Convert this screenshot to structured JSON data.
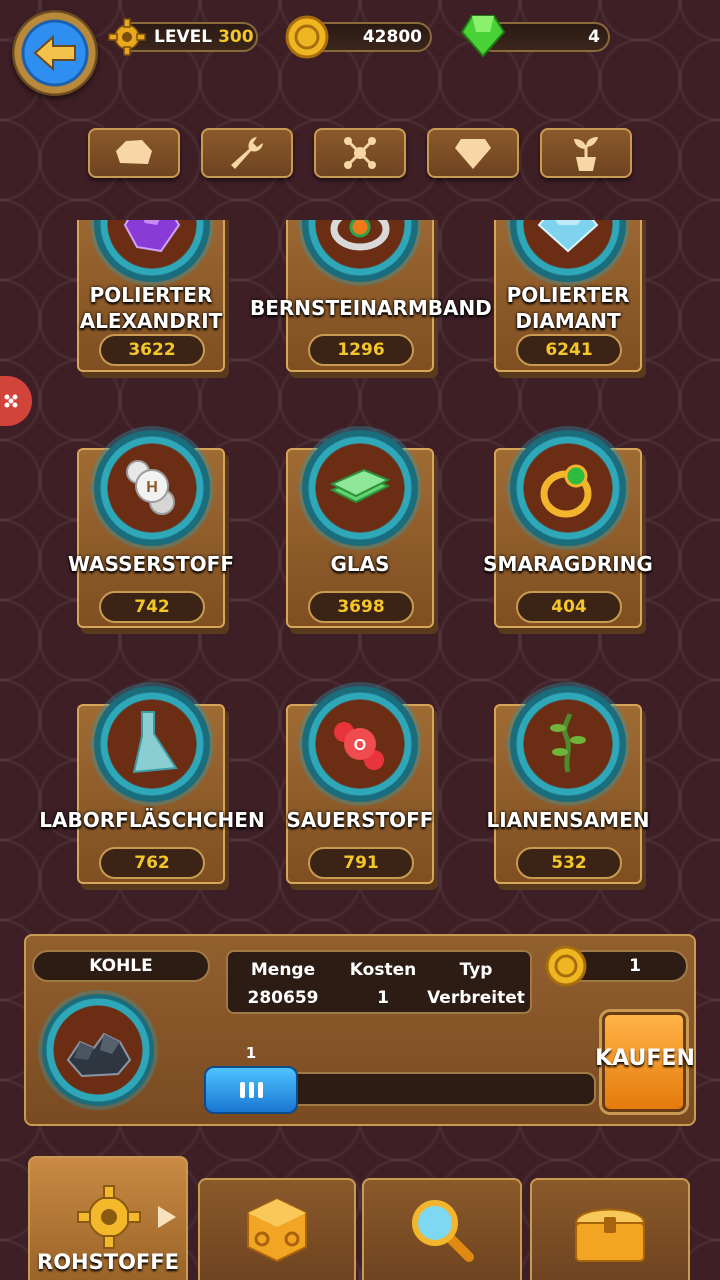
{
  "header": {
    "level_label": "LEVEL",
    "level_value": "300",
    "coins": "42800",
    "gems": "4"
  },
  "categories": [
    "rock-icon",
    "wrench-icon",
    "molecule-icon",
    "diamond-icon",
    "plant-icon"
  ],
  "items": [
    {
      "name": "POLIERTER ALEXANDRIT",
      "count": "3622",
      "icon": "alexandrite-icon"
    },
    {
      "name": "BERNSTEINARMBAND",
      "count": "1296",
      "icon": "amber-bracelet-icon"
    },
    {
      "name": "POLIERTER DIAMANT",
      "count": "6241",
      "icon": "diamond-gem-icon"
    },
    {
      "name": "WASSERSTOFF",
      "count": "742",
      "icon": "hydrogen-icon"
    },
    {
      "name": "GLAS",
      "count": "3698",
      "icon": "glass-icon"
    },
    {
      "name": "SMARAGDRING",
      "count": "404",
      "icon": "emerald-ring-icon"
    },
    {
      "name": "LABORFLÄSCHCHEN",
      "count": "762",
      "icon": "flask-icon"
    },
    {
      "name": "SAUERSTOFF",
      "count": "791",
      "icon": "oxygen-icon"
    },
    {
      "name": "LIANENSAMEN",
      "count": "532",
      "icon": "vine-seed-icon"
    }
  ],
  "purchase": {
    "selected_name": "KOHLE",
    "col_amount": "Menge",
    "col_cost": "Kosten",
    "col_type": "Typ",
    "amount": "280659",
    "cost": "1",
    "type": "Verbreitet",
    "price": "1",
    "quantity": "1",
    "buy_label": "KAUFEN",
    "slider_fraction": 0.0
  },
  "nav": {
    "active_label": "ROHSTOFFE",
    "tabs": [
      "gear-icon",
      "dice-icon",
      "magnifier-icon",
      "chest-icon"
    ]
  }
}
